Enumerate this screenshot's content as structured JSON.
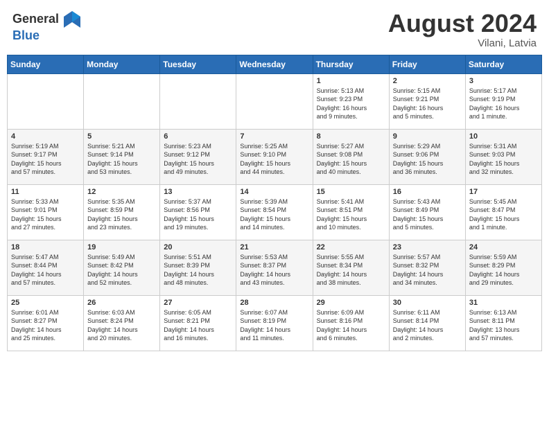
{
  "header": {
    "logo_general": "General",
    "logo_blue": "Blue",
    "month_title": "August 2024",
    "location": "Vilani, Latvia"
  },
  "weekdays": [
    "Sunday",
    "Monday",
    "Tuesday",
    "Wednesday",
    "Thursday",
    "Friday",
    "Saturday"
  ],
  "weeks": [
    [
      {
        "day": "",
        "info": ""
      },
      {
        "day": "",
        "info": ""
      },
      {
        "day": "",
        "info": ""
      },
      {
        "day": "",
        "info": ""
      },
      {
        "day": "1",
        "info": "Sunrise: 5:13 AM\nSunset: 9:23 PM\nDaylight: 16 hours\nand 9 minutes."
      },
      {
        "day": "2",
        "info": "Sunrise: 5:15 AM\nSunset: 9:21 PM\nDaylight: 16 hours\nand 5 minutes."
      },
      {
        "day": "3",
        "info": "Sunrise: 5:17 AM\nSunset: 9:19 PM\nDaylight: 16 hours\nand 1 minute."
      }
    ],
    [
      {
        "day": "4",
        "info": "Sunrise: 5:19 AM\nSunset: 9:17 PM\nDaylight: 15 hours\nand 57 minutes."
      },
      {
        "day": "5",
        "info": "Sunrise: 5:21 AM\nSunset: 9:14 PM\nDaylight: 15 hours\nand 53 minutes."
      },
      {
        "day": "6",
        "info": "Sunrise: 5:23 AM\nSunset: 9:12 PM\nDaylight: 15 hours\nand 49 minutes."
      },
      {
        "day": "7",
        "info": "Sunrise: 5:25 AM\nSunset: 9:10 PM\nDaylight: 15 hours\nand 44 minutes."
      },
      {
        "day": "8",
        "info": "Sunrise: 5:27 AM\nSunset: 9:08 PM\nDaylight: 15 hours\nand 40 minutes."
      },
      {
        "day": "9",
        "info": "Sunrise: 5:29 AM\nSunset: 9:06 PM\nDaylight: 15 hours\nand 36 minutes."
      },
      {
        "day": "10",
        "info": "Sunrise: 5:31 AM\nSunset: 9:03 PM\nDaylight: 15 hours\nand 32 minutes."
      }
    ],
    [
      {
        "day": "11",
        "info": "Sunrise: 5:33 AM\nSunset: 9:01 PM\nDaylight: 15 hours\nand 27 minutes."
      },
      {
        "day": "12",
        "info": "Sunrise: 5:35 AM\nSunset: 8:59 PM\nDaylight: 15 hours\nand 23 minutes."
      },
      {
        "day": "13",
        "info": "Sunrise: 5:37 AM\nSunset: 8:56 PM\nDaylight: 15 hours\nand 19 minutes."
      },
      {
        "day": "14",
        "info": "Sunrise: 5:39 AM\nSunset: 8:54 PM\nDaylight: 15 hours\nand 14 minutes."
      },
      {
        "day": "15",
        "info": "Sunrise: 5:41 AM\nSunset: 8:51 PM\nDaylight: 15 hours\nand 10 minutes."
      },
      {
        "day": "16",
        "info": "Sunrise: 5:43 AM\nSunset: 8:49 PM\nDaylight: 15 hours\nand 5 minutes."
      },
      {
        "day": "17",
        "info": "Sunrise: 5:45 AM\nSunset: 8:47 PM\nDaylight: 15 hours\nand 1 minute."
      }
    ],
    [
      {
        "day": "18",
        "info": "Sunrise: 5:47 AM\nSunset: 8:44 PM\nDaylight: 14 hours\nand 57 minutes."
      },
      {
        "day": "19",
        "info": "Sunrise: 5:49 AM\nSunset: 8:42 PM\nDaylight: 14 hours\nand 52 minutes."
      },
      {
        "day": "20",
        "info": "Sunrise: 5:51 AM\nSunset: 8:39 PM\nDaylight: 14 hours\nand 48 minutes."
      },
      {
        "day": "21",
        "info": "Sunrise: 5:53 AM\nSunset: 8:37 PM\nDaylight: 14 hours\nand 43 minutes."
      },
      {
        "day": "22",
        "info": "Sunrise: 5:55 AM\nSunset: 8:34 PM\nDaylight: 14 hours\nand 38 minutes."
      },
      {
        "day": "23",
        "info": "Sunrise: 5:57 AM\nSunset: 8:32 PM\nDaylight: 14 hours\nand 34 minutes."
      },
      {
        "day": "24",
        "info": "Sunrise: 5:59 AM\nSunset: 8:29 PM\nDaylight: 14 hours\nand 29 minutes."
      }
    ],
    [
      {
        "day": "25",
        "info": "Sunrise: 6:01 AM\nSunset: 8:27 PM\nDaylight: 14 hours\nand 25 minutes."
      },
      {
        "day": "26",
        "info": "Sunrise: 6:03 AM\nSunset: 8:24 PM\nDaylight: 14 hours\nand 20 minutes."
      },
      {
        "day": "27",
        "info": "Sunrise: 6:05 AM\nSunset: 8:21 PM\nDaylight: 14 hours\nand 16 minutes."
      },
      {
        "day": "28",
        "info": "Sunrise: 6:07 AM\nSunset: 8:19 PM\nDaylight: 14 hours\nand 11 minutes."
      },
      {
        "day": "29",
        "info": "Sunrise: 6:09 AM\nSunset: 8:16 PM\nDaylight: 14 hours\nand 6 minutes."
      },
      {
        "day": "30",
        "info": "Sunrise: 6:11 AM\nSunset: 8:14 PM\nDaylight: 14 hours\nand 2 minutes."
      },
      {
        "day": "31",
        "info": "Sunrise: 6:13 AM\nSunset: 8:11 PM\nDaylight: 13 hours\nand 57 minutes."
      }
    ]
  ]
}
